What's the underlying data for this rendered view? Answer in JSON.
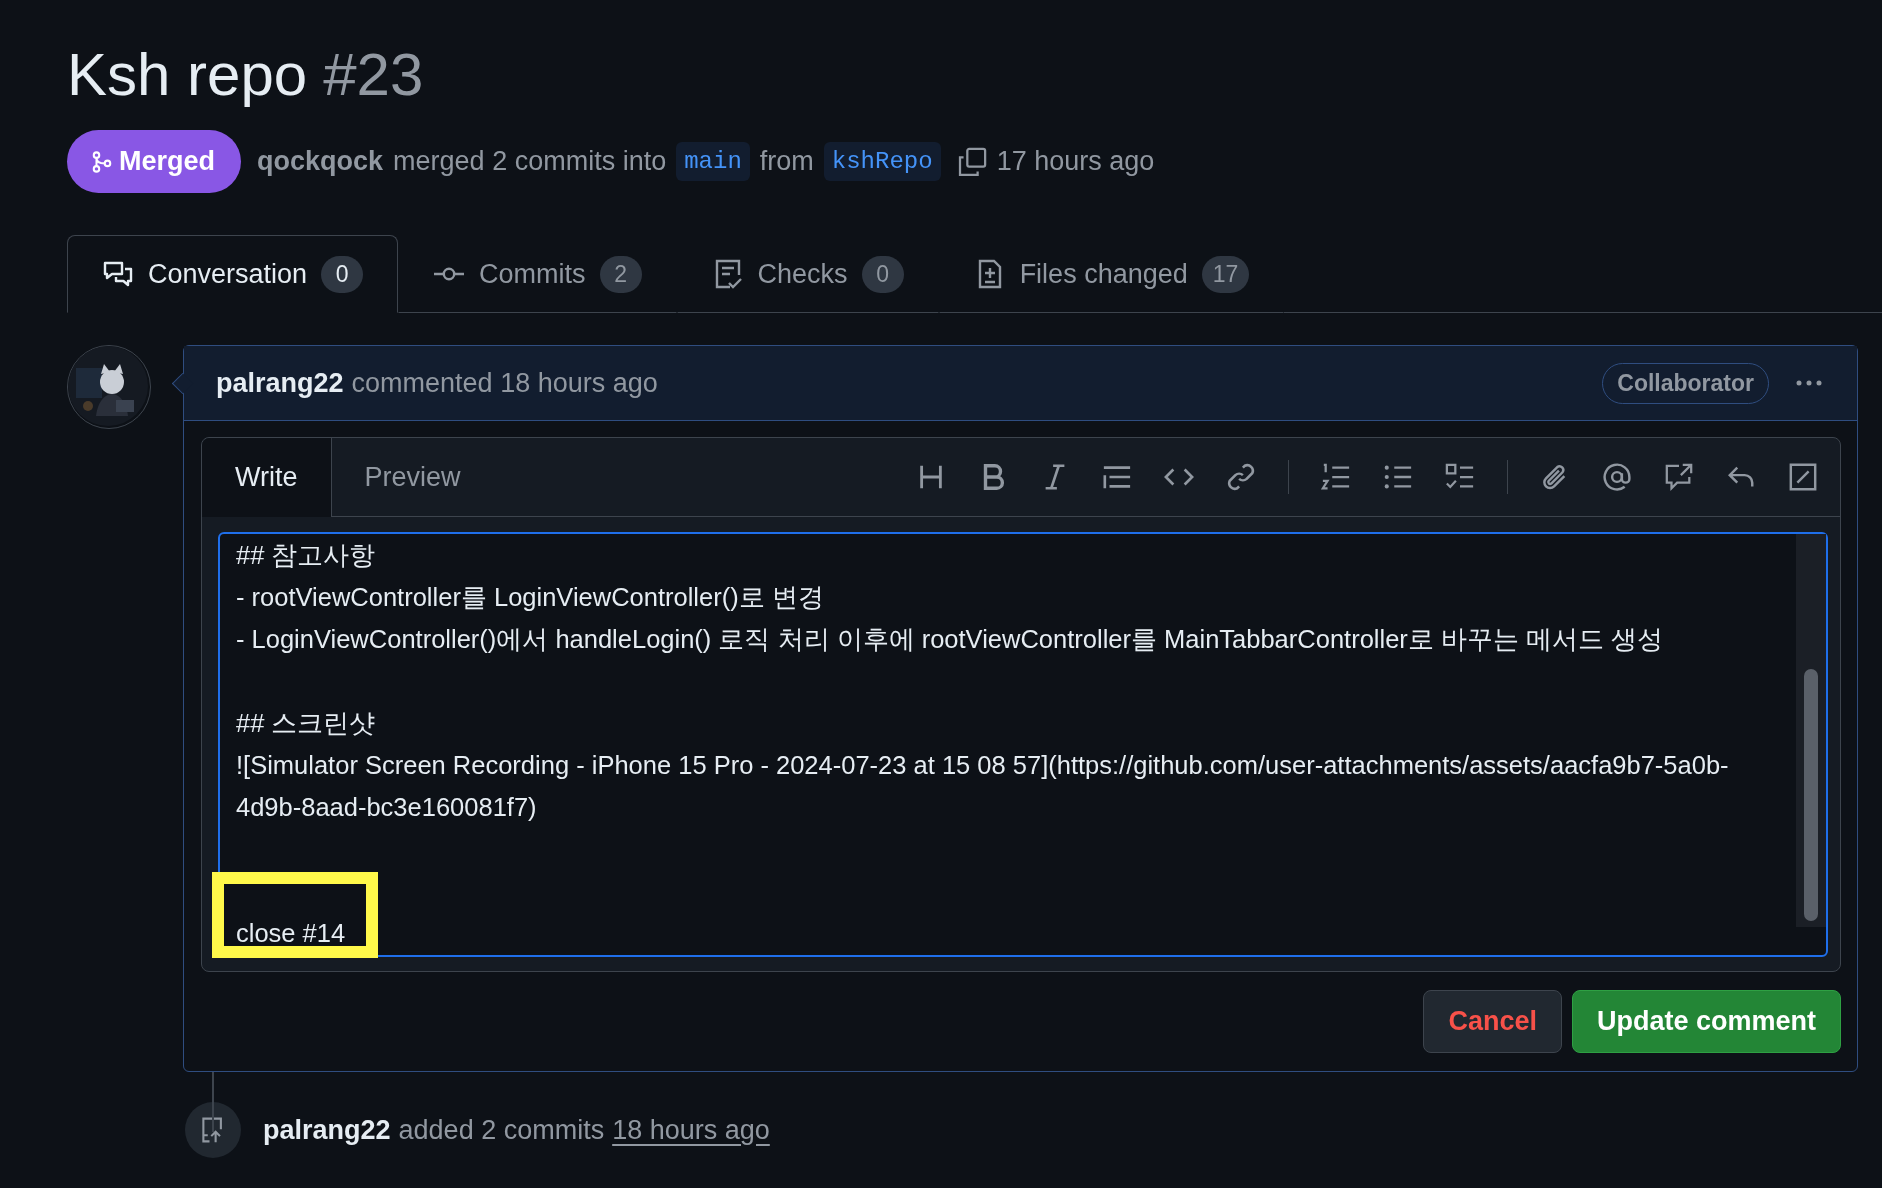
{
  "pull_request": {
    "title": "Ksh repo",
    "number": "#23",
    "state": {
      "label": "Merged",
      "kind": "merged"
    },
    "author": "qockqock",
    "summary": "merged 2 commits into",
    "base_branch": "main",
    "from_word": "from",
    "head_branch": "kshRepo",
    "time": "17 hours ago"
  },
  "tabs": [
    {
      "label": "Conversation",
      "count": "0",
      "selected": true,
      "kind": "conversation"
    },
    {
      "label": "Commits",
      "count": "2",
      "selected": false,
      "kind": "commits"
    },
    {
      "label": "Checks",
      "count": "0",
      "selected": false,
      "kind": "checks"
    },
    {
      "label": "Files changed",
      "count": "17",
      "selected": false,
      "kind": "files"
    }
  ],
  "comment": {
    "author": "palrang22",
    "action": "commented 18 hours ago",
    "role": "Collaborator",
    "editor_tabs": [
      {
        "label": "Write",
        "selected": true
      },
      {
        "label": "Preview",
        "selected": false
      }
    ],
    "body": "## 참고사항\n- rootViewController를 LoginViewController()로 변경\n- LoginViewController()에서 handleLogin() 로직 처리 이후에 rootViewController를 MainTabbarController로 바꾸는 메서드 생성\n\n## 스크린샷\n![Simulator Screen Recording - iPhone 15 Pro - 2024-07-23 at 15 08 57](https://github.com/user-attachments/assets/aacfa9b7-5a0b-4d9b-8aad-bc3e160081f7)\n\n\nclose #14",
    "cancel": "Cancel",
    "submit": "Update comment"
  },
  "timeline": [
    {
      "author": "palrang22",
      "action": "added 2 commits",
      "time": "18 hours ago"
    }
  ]
}
